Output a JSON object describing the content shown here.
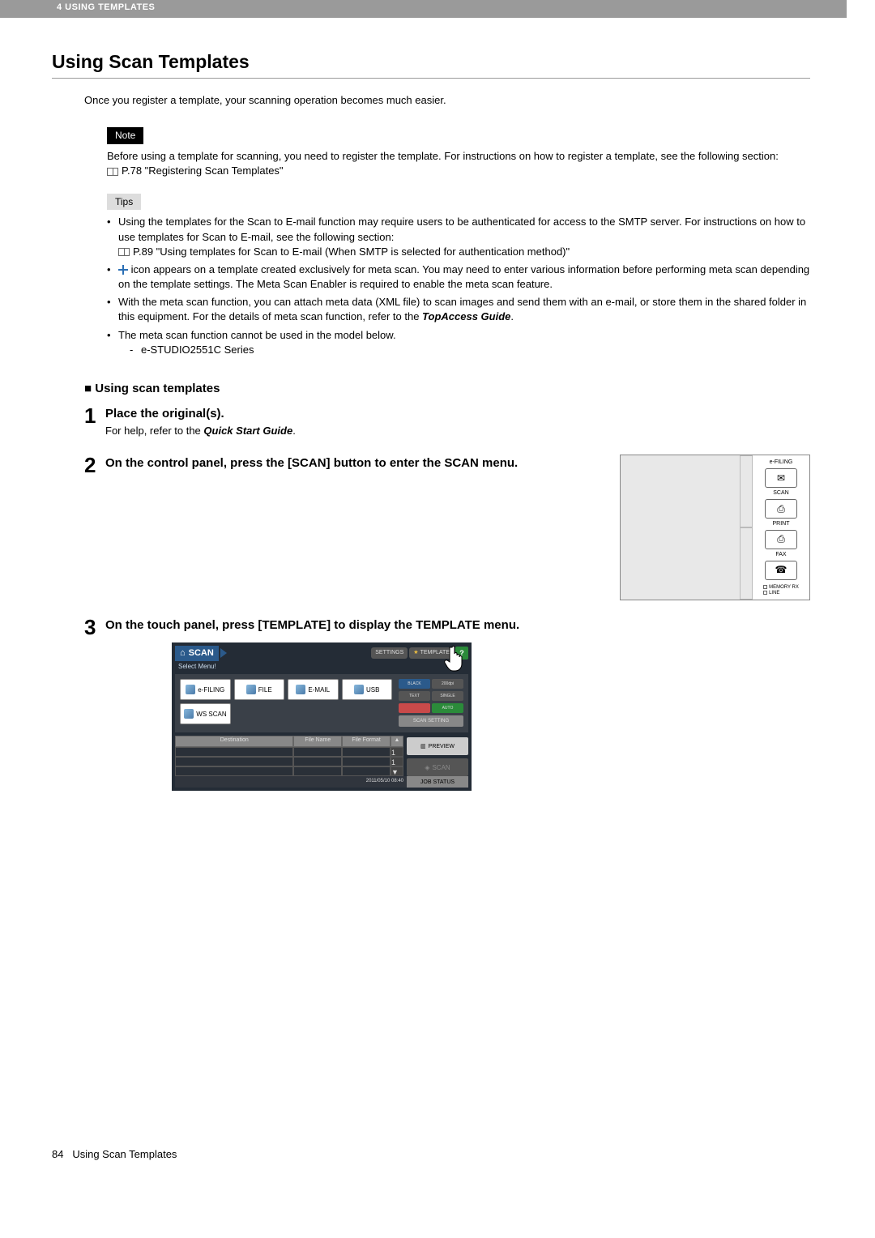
{
  "header": {
    "chapter": "4 USING TEMPLATES"
  },
  "title": "Using Scan Templates",
  "intro": "Once you register a template, your scanning operation becomes much easier.",
  "note": {
    "tag": "Note",
    "text": "Before using a template for scanning, you need to register the template. For instructions on how to register a template, see the following section:",
    "ref": "P.78 \"Registering Scan Templates\""
  },
  "tips": {
    "tag": "Tips",
    "items": [
      {
        "lead": "Using the templates for the Scan to E-mail function may require users to be authenticated for access to the SMTP server. For instructions on how to use templates for Scan to E-mail, see the following section:",
        "ref": "P.89 \"Using templates for Scan to E-mail (When SMTP is selected for authentication method)\""
      },
      {
        "plus": true,
        "lead_after": " icon appears on a template created exclusively for meta scan. You may need to enter various information before performing meta scan depending on the template settings. The Meta Scan Enabler is required to enable the meta scan feature."
      },
      {
        "lead": "With the meta scan function, you can attach meta data (XML file) to scan images and send them with an e-mail, or store them in the shared folder in this equipment. For the details of meta scan function, refer to the ",
        "bold": "TopAccess Guide",
        "tail": "."
      },
      {
        "lead": "The meta scan function cannot be used in the model below.",
        "sub": "e-STUDIO2551C Series"
      }
    ]
  },
  "subsection": "Using scan templates",
  "steps": [
    {
      "num": "1",
      "title": "Place the original(s).",
      "sub_pre": "For help, refer to the ",
      "sub_bold": "Quick Start Guide",
      "sub_post": "."
    },
    {
      "num": "2",
      "title": "On the control panel, press the [SCAN] button to enter the SCAN menu."
    },
    {
      "num": "3",
      "title": "On the touch panel, press [TEMPLATE] to display the TEMPLATE menu."
    }
  ],
  "panel": {
    "buttons": [
      "e-FILING",
      "SCAN",
      "PRINT",
      "FAX"
    ],
    "icons": [
      "✉",
      "⎙",
      "⎙",
      "☎"
    ],
    "status": [
      "MEMORY RX",
      "LINE"
    ]
  },
  "touch": {
    "scan": "SCAN",
    "settings": "SETTINGS",
    "template": "TEMPLATE",
    "help": "?",
    "selectmenu": "Select Menu!",
    "fn": [
      "e-FILING",
      "FILE",
      "E-MAIL",
      "USB",
      "WS SCAN"
    ],
    "chips_row1": [
      "BLACK",
      "200dpi"
    ],
    "chips_row2": [
      "TEXT",
      "SINGLE"
    ],
    "chips_row3": [
      "",
      "AUTO"
    ],
    "scansetting": "SCAN SETTING",
    "th": [
      "Destination",
      "File Name",
      "File Format"
    ],
    "preview": "PREVIEW",
    "scanbtn": "SCAN",
    "pagenum": "1",
    "date": "2011/05/10\n08:40",
    "jobstatus": "JOB STATUS"
  },
  "footer": {
    "pagenum": "84",
    "title": "Using Scan Templates"
  }
}
